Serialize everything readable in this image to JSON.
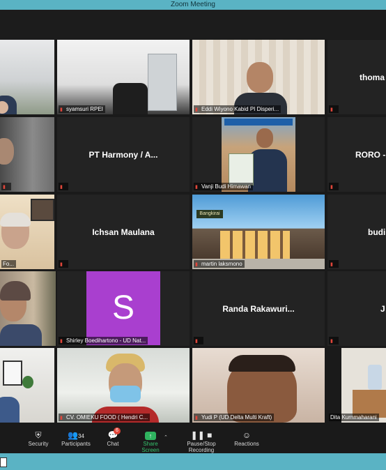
{
  "window": {
    "title": "Zoom Meeting"
  },
  "tiles": {
    "r1c2": {
      "label": "syamsuri RPEI"
    },
    "r1c3": {
      "label": "Eddi Wiyono Kabid PI Disperi..."
    },
    "r1c4": {
      "name": "thoma"
    },
    "r2c2": {
      "name": "PT Harmony / A..."
    },
    "r2c3": {
      "label": "Vanji Budi Himawan"
    },
    "r2c4": {
      "name": "RORO -"
    },
    "r3c1": {
      "label": "Fo..."
    },
    "r3c2": {
      "name": "Ichsan Maulana"
    },
    "r3c3": {
      "label": "martin laksmono",
      "sign": "Bangkirai"
    },
    "r3c4": {
      "name": "budi"
    },
    "r4c2": {
      "label": "Shirley Boedihartono - UD Nat...",
      "initial": "S"
    },
    "r4c3": {
      "name": "Randa Rakawuri..."
    },
    "r4c4": {
      "name": "J"
    },
    "r5c2": {
      "label": "CV. OMIEKU FOOD ( Hendri C..."
    },
    "r5c3": {
      "label": "Yudi P (UD Delta Multi Kraft)"
    },
    "r5c4": {
      "label": "Dita Kurnmaharani"
    }
  },
  "toolbar": {
    "security": "Security",
    "participants": "Participants",
    "participants_count": "34",
    "chat": "Chat",
    "chat_badge": "6",
    "share": "Share Screen",
    "record": "Pause/Stop Recording",
    "reactions": "Reactions"
  },
  "colors": {
    "titlebar": "#5ab3c4",
    "share": "#2fb35f",
    "avatar": "#a93fcf",
    "active_speaker": "#e8d23a"
  }
}
